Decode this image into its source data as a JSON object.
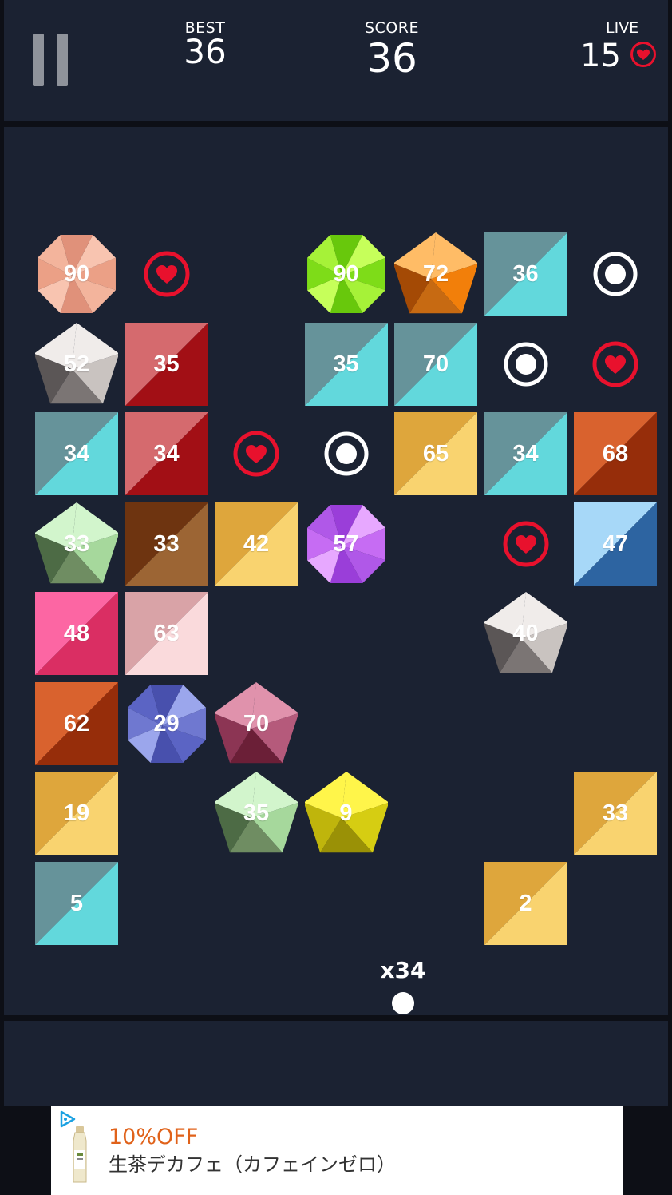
{
  "header": {
    "best_label": "BEST",
    "best_value": "36",
    "score_label": "SCORE",
    "score_value": "36",
    "live_label": "LIVE",
    "live_value": "15",
    "pause_icon": "pause-icon",
    "heart_icon": "heart-icon"
  },
  "colors": {
    "background": "#1b2232",
    "heart_red": "#e8112d",
    "white": "#ffffff"
  },
  "board": {
    "ball_multiplier": "x34",
    "items": [
      {
        "row": 0,
        "col": 0,
        "type": "octagon",
        "value": "90",
        "palette": "peach"
      },
      {
        "row": 0,
        "col": 1,
        "type": "heart"
      },
      {
        "row": 0,
        "col": 3,
        "type": "octagon",
        "value": "90",
        "palette": "lime"
      },
      {
        "row": 0,
        "col": 4,
        "type": "pentagon",
        "value": "72",
        "palette": "orange"
      },
      {
        "row": 0,
        "col": 5,
        "type": "square",
        "value": "36",
        "palette": "cyan"
      },
      {
        "row": 0,
        "col": 6,
        "type": "ring"
      },
      {
        "row": 1,
        "col": 0,
        "type": "pentagon",
        "value": "52",
        "palette": "gray"
      },
      {
        "row": 1,
        "col": 1,
        "type": "square",
        "value": "35",
        "palette": "red"
      },
      {
        "row": 1,
        "col": 3,
        "type": "square",
        "value": "35",
        "palette": "cyan"
      },
      {
        "row": 1,
        "col": 4,
        "type": "square",
        "value": "70",
        "palette": "cyan"
      },
      {
        "row": 1,
        "col": 5,
        "type": "ring"
      },
      {
        "row": 1,
        "col": 6,
        "type": "heart"
      },
      {
        "row": 2,
        "col": 0,
        "type": "square",
        "value": "34",
        "palette": "cyan"
      },
      {
        "row": 2,
        "col": 1,
        "type": "square",
        "value": "34",
        "palette": "red"
      },
      {
        "row": 2,
        "col": 2,
        "type": "heart"
      },
      {
        "row": 2,
        "col": 3,
        "type": "ring"
      },
      {
        "row": 2,
        "col": 4,
        "type": "square",
        "value": "65",
        "palette": "gold"
      },
      {
        "row": 2,
        "col": 5,
        "type": "square",
        "value": "34",
        "palette": "cyan"
      },
      {
        "row": 2,
        "col": 6,
        "type": "square",
        "value": "68",
        "palette": "rust"
      },
      {
        "row": 3,
        "col": 0,
        "type": "pentagon",
        "value": "33",
        "palette": "mint"
      },
      {
        "row": 3,
        "col": 1,
        "type": "square",
        "value": "33",
        "palette": "brown"
      },
      {
        "row": 3,
        "col": 2,
        "type": "square",
        "value": "42",
        "palette": "gold"
      },
      {
        "row": 3,
        "col": 3,
        "type": "octagon",
        "value": "57",
        "palette": "violet"
      },
      {
        "row": 3,
        "col": 5,
        "type": "heart"
      },
      {
        "row": 3,
        "col": 6,
        "type": "square",
        "value": "47",
        "palette": "blue"
      },
      {
        "row": 4,
        "col": 0,
        "type": "square",
        "value": "48",
        "palette": "pink"
      },
      {
        "row": 4,
        "col": 1,
        "type": "square",
        "value": "63",
        "palette": "blush"
      },
      {
        "row": 4,
        "col": 5,
        "type": "pentagon",
        "value": "40",
        "palette": "gray"
      },
      {
        "row": 5,
        "col": 0,
        "type": "square",
        "value": "62",
        "palette": "rust"
      },
      {
        "row": 5,
        "col": 1,
        "type": "octagon",
        "value": "29",
        "palette": "periwinkle"
      },
      {
        "row": 5,
        "col": 2,
        "type": "pentagon",
        "value": "70",
        "palette": "plum"
      },
      {
        "row": 6,
        "col": 0,
        "type": "square",
        "value": "19",
        "palette": "gold"
      },
      {
        "row": 6,
        "col": 2,
        "type": "pentagon",
        "value": "35",
        "palette": "mint"
      },
      {
        "row": 6,
        "col": 3,
        "type": "pentagon",
        "value": "9",
        "palette": "yellow"
      },
      {
        "row": 6,
        "col": 6,
        "type": "square",
        "value": "33",
        "palette": "gold"
      },
      {
        "row": 7,
        "col": 0,
        "type": "square",
        "value": "5",
        "palette": "cyan"
      },
      {
        "row": 7,
        "col": 5,
        "type": "square",
        "value": "2",
        "palette": "gold"
      }
    ]
  },
  "ad": {
    "line1": "10%OFF",
    "line2": "生茶デカフェ（カフェインゼロ）",
    "adchoices_icon": "adchoices-icon",
    "product_image": "tea-bottle-image"
  }
}
